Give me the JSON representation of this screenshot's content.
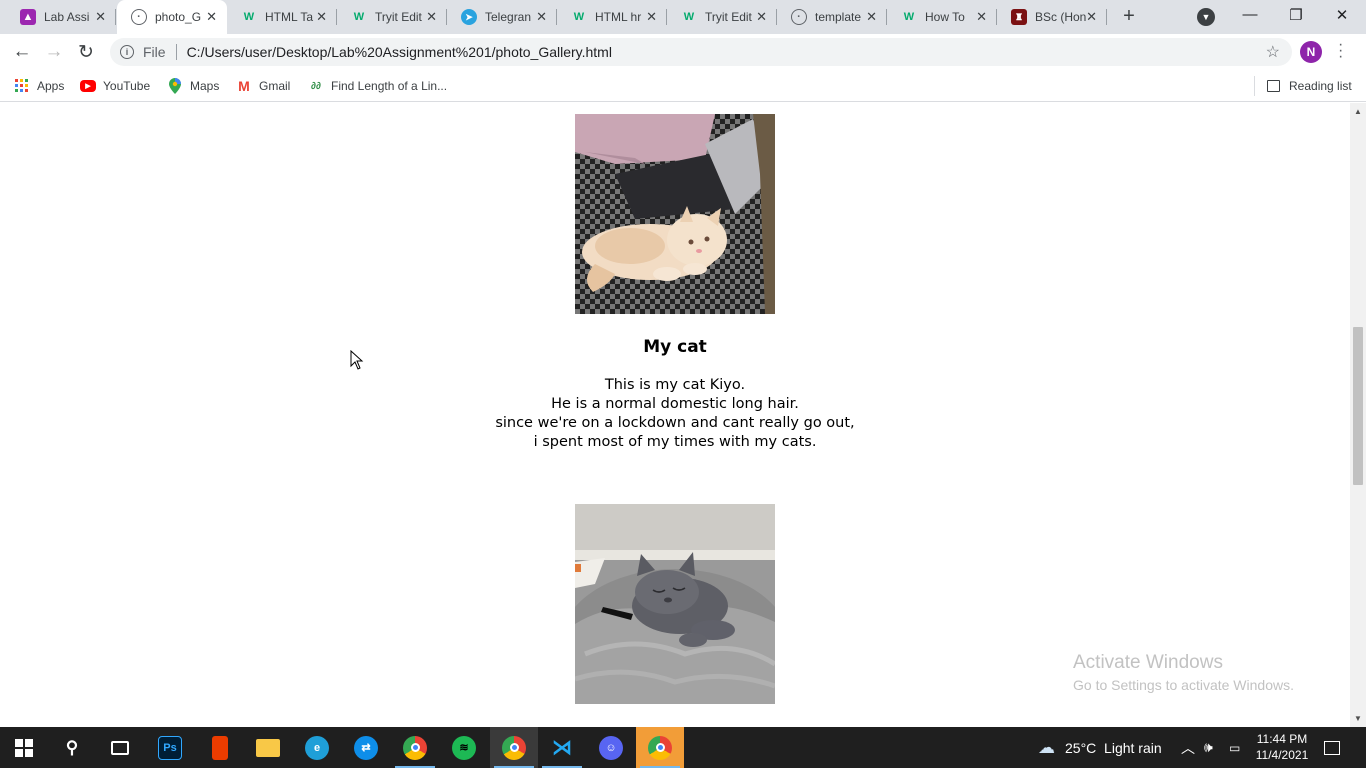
{
  "browser": {
    "tabs": [
      {
        "title": "Lab Assi",
        "icon": "classroom-icon",
        "color": "#9c27b0"
      },
      {
        "title": "photo_G",
        "icon": "globe-icon",
        "color": "#5f6368",
        "active": true
      },
      {
        "title": "HTML Ta",
        "icon": "w3schools-icon",
        "color": "#04aa6d"
      },
      {
        "title": "Tryit Edit",
        "icon": "w3schools-icon",
        "color": "#04aa6d"
      },
      {
        "title": "Telegran",
        "icon": "telegram-icon",
        "color": "#2aa3df"
      },
      {
        "title": "HTML hr",
        "icon": "w3schools-icon",
        "color": "#04aa6d"
      },
      {
        "title": "Tryit Edit",
        "icon": "w3schools-icon",
        "color": "#04aa6d"
      },
      {
        "title": "template",
        "icon": "globe-icon",
        "color": "#5f6368"
      },
      {
        "title": "How To",
        "icon": "w3schools-icon",
        "color": "#04aa6d"
      },
      {
        "title": "BSc (Hon",
        "icon": "shield-icon",
        "color": "#7b1113"
      }
    ],
    "address": {
      "scheme": "File",
      "url": "C:/Users/user/Desktop/Lab%20Assignment%201/photo_Gallery.html"
    },
    "profile_initial": "N",
    "bookmarks": [
      {
        "label": "Apps",
        "icon": "apps-grid-icon"
      },
      {
        "label": "YouTube",
        "icon": "youtube-icon"
      },
      {
        "label": "Maps",
        "icon": "maps-pin-icon"
      },
      {
        "label": "Gmail",
        "icon": "gmail-icon"
      },
      {
        "label": "Find Length of a Lin...",
        "icon": "geeks-icon"
      }
    ],
    "reading_list": "Reading list"
  },
  "page": {
    "section": {
      "title": "My cat",
      "lines": [
        "This is my cat Kiyo.",
        "He is a normal domestic long hair.",
        "since we're on a lockdown and cant really go out,",
        "i spent most of my times with my cats."
      ]
    },
    "watermark": {
      "line1": "Activate Windows",
      "line2": "Go to Settings to activate Windows."
    }
  },
  "taskbar": {
    "weather": "25°C  Light rain",
    "time": "11:44 PM",
    "date": "11/4/2021"
  }
}
